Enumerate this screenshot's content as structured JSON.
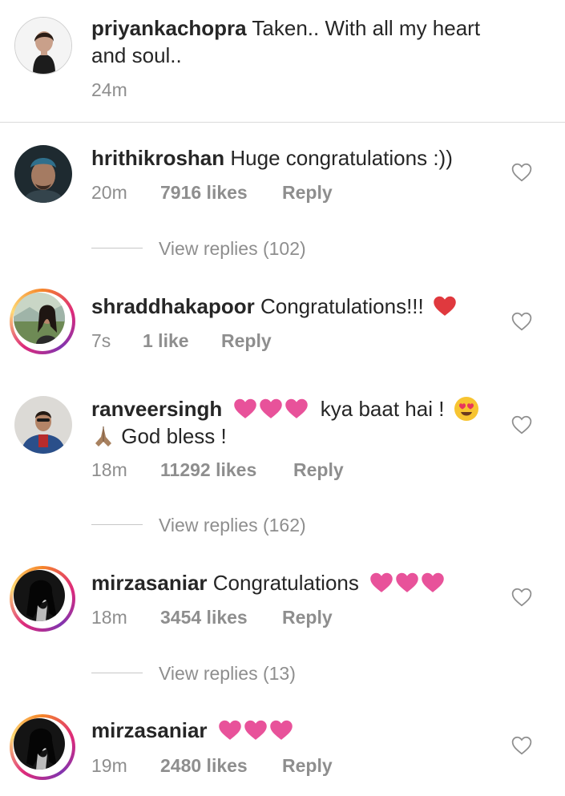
{
  "caption": {
    "username": "priyankachopra",
    "text": "Taken.. With all my heart and soul..",
    "time": "24m"
  },
  "comments": [
    {
      "username": "hrithikroshan",
      "text": "Huge congratulations :))",
      "time": "20m",
      "likes": "7916 likes",
      "reply": "Reply",
      "view_replies": "View replies (102)"
    },
    {
      "username": "shraddhakapoor",
      "text": "Congratulations!!!",
      "text_emoji": "red-heart",
      "time": "7s",
      "likes": "1 like",
      "reply": "Reply"
    },
    {
      "username": "ranveersingh",
      "text_after_hearts": "kya baat hai !",
      "text_line2": "God bless !",
      "emojis": [
        "pink-heart",
        "pink-heart",
        "pink-heart",
        "heart-eyes",
        "folded-hands"
      ],
      "time": "18m",
      "likes": "11292 likes",
      "reply": "Reply",
      "view_replies": "View replies (162)"
    },
    {
      "username": "mirzasaniar",
      "text": "Congratulations",
      "emojis": [
        "pink-heart",
        "pink-heart",
        "pink-heart"
      ],
      "time": "18m",
      "likes": "3454 likes",
      "reply": "Reply",
      "view_replies": "View replies (13)"
    },
    {
      "username": "mirzasaniar",
      "emojis": [
        "pink-heart",
        "pink-heart",
        "pink-heart"
      ],
      "time": "19m",
      "likes": "2480 likes",
      "reply": "Reply"
    }
  ],
  "colors": {
    "text": "#262626",
    "secondary": "#8e8e8e",
    "red_heart": "#ed4956",
    "pink_heart": "#e8529a",
    "divider": "#dbdbdb"
  }
}
